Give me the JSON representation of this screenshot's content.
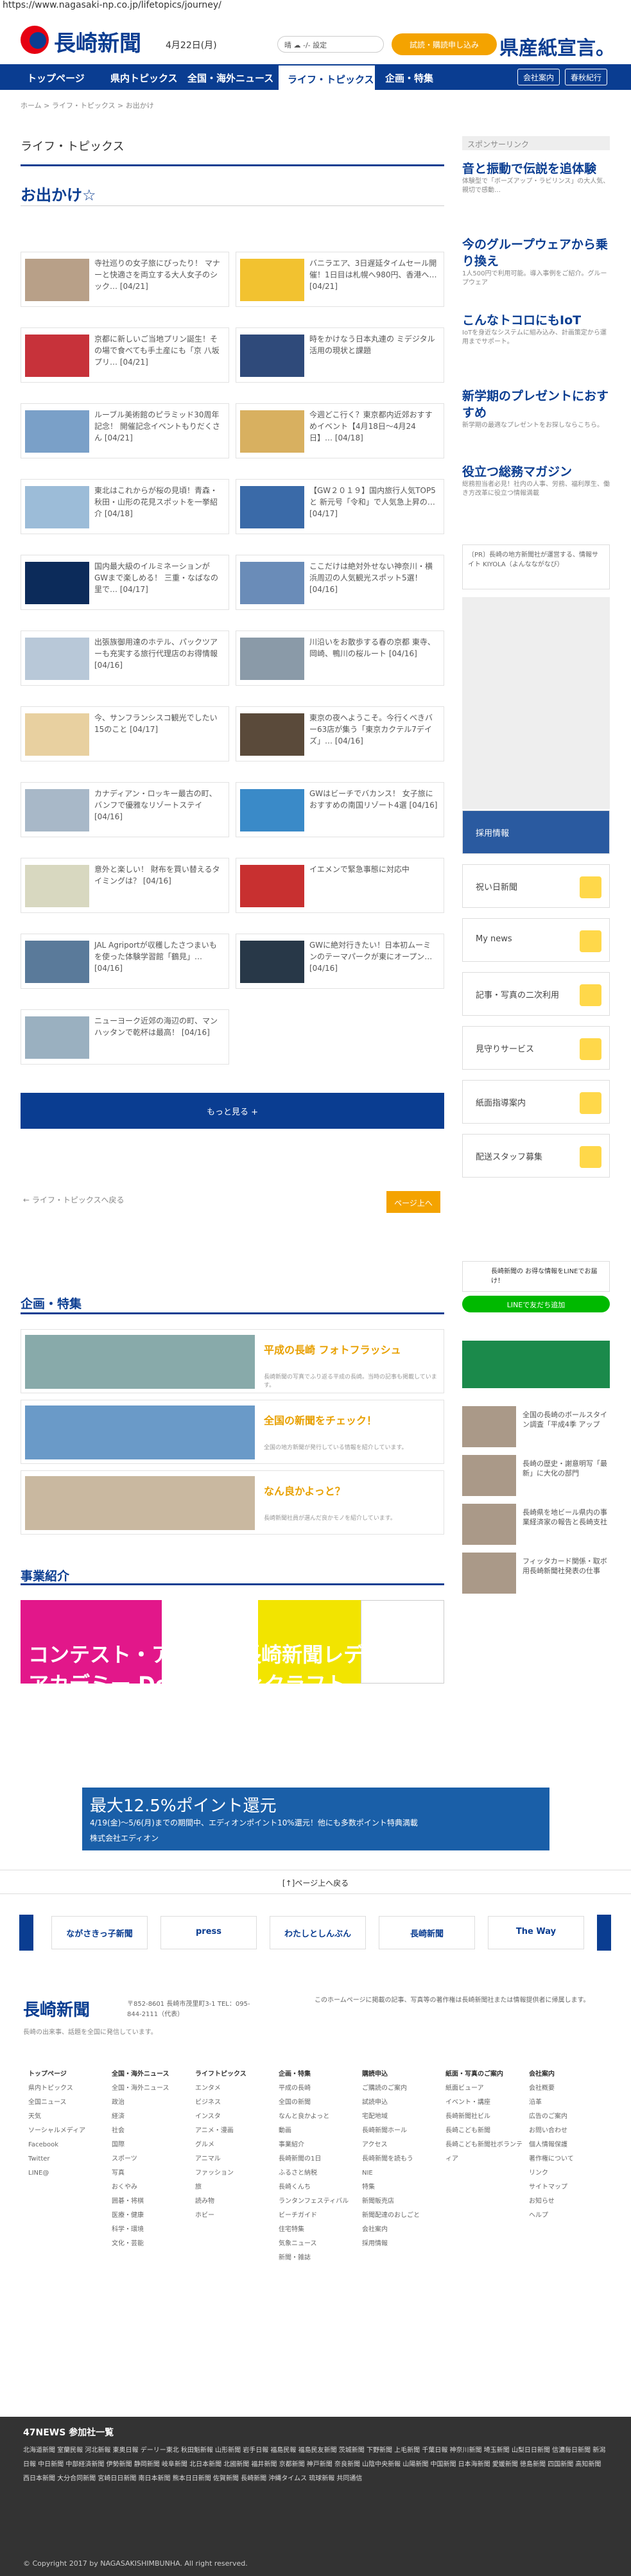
{
  "browser": {
    "url": "https://www.nagasaki-np.co.jp/lifetopics/journey/"
  },
  "header": {
    "logo": "長崎新聞",
    "date": "4月22日(月)",
    "weather": "晴 ☁ -/- 設定",
    "trial_label": "試読・購読申し込み",
    "campaign": "県産紙宣言。"
  },
  "gnav": {
    "items": [
      "トップページ",
      "県内トピックス",
      "全国・海外ニュース",
      "ライフ・トピックス",
      "企画・特集"
    ],
    "right": [
      "会社案内",
      "春秋紀行"
    ]
  },
  "breadcrumb": "ホーム > ライフ・トピックス > お出かけ",
  "section_title": "ライフ・トピックス",
  "page_heading": "お出かけ☆",
  "articles": [
    {
      "text": "寺社巡りの女子旅にぴったり！ マナーと快適さを両立する大人女子のシック… [04/21]"
    },
    {
      "text": "バニラエア、3日遅延タイムセール開催！1日目は札幌へ980円、香港へ… [04/21]"
    },
    {
      "text": "京都に新しいご当地プリン誕生！その場で食べても手土産にも「京 八坂プリ… [04/21]"
    },
    {
      "text": "時をかけなう日本丸連の ミデジタル活用の現状と課題"
    },
    {
      "text": "ルーブル美術館のピラミッド30周年記念！ 開催記念イベントもりだくさん [04/21]"
    },
    {
      "text": "今週どこ行く？東京都内近郊おすすめイベント【4月18日～4月24日】… [04/18]"
    },
    {
      "text": "東北はこれからが桜の見頃！青森・秋田・山形の花見スポットを一挙紹介 [04/18]"
    },
    {
      "text": "【GW２０１９】国内旅行人気TOP5と 新元号「令和」で人気急上昇の…[04/17]"
    },
    {
      "text": "国内最大級のイルミネーションがGWまで楽しめる！ 三重・なばなの里で… [04/17]"
    },
    {
      "text": "ここだけは絶対外せない神奈川・横浜周辺の人気観光スポット5選！[04/16]"
    },
    {
      "text": "出張族御用達のホテル、パックツアーも充実する旅行代理店のお得情報 [04/16]"
    },
    {
      "text": "川沿いをお散歩する春の京都 東寺、岡崎、鴨川の桜ルート [04/16]"
    },
    {
      "text": "今、サンフランシスコ観光でしたい15のこと [04/17]"
    },
    {
      "text": "東京の夜へようこそ。今行くべきバー63店が集う「東京カクテル7デイズ」… [04/16]"
    },
    {
      "text": "カナディアン・ロッキー最古の町、バンフで優雅なリゾートステイ [04/16]"
    },
    {
      "text": "GWはビーチでバカンス！ 女子旅におすすめの南国リゾート4選 [04/16]"
    },
    {
      "text": "意外と楽しい！ 財布を買い替えるタイミングは？ [04/16]"
    },
    {
      "text": "イエメンで緊急事態に対応中"
    },
    {
      "text": "JAL Agriportが収穫したさつまいもを使った体験学習館「鶴見」… [04/16]"
    },
    {
      "text": "GWに絶対行きたい！日本初ムーミンのテーマパークが東にオープン… [04/16]"
    },
    {
      "text": "ニューヨーク近郊の海辺の町、マンハッタンで乾杯は最高！ [04/16]"
    }
  ],
  "more_label": "もっと見る +",
  "back_left": "← ライフ・トピックスへ戻る",
  "back_right": "ページ上へ",
  "kikaku": {
    "heading": "企画・特集",
    "items": [
      {
        "title": "平成の長崎 フォトフラッシュ",
        "desc": "長崎新聞の写真でふり返る平成の長崎。当時の記事も掲載しています。"
      },
      {
        "title": "全国の新聞をチェック！",
        "desc": "全国の地方新聞が発行している情報を紹介しています。"
      },
      {
        "title": "なん良かよっと？",
        "desc": "長崎新聞社員が選んだ良かモノを紹介しています。"
      }
    ]
  },
  "jigyo": {
    "heading": "事業紹介",
    "banner": "コンテスト・アワード 長崎新聞レディスアカデミー Do-iT 地域×クラフト"
  },
  "ad_wide": {
    "line1": "最大12.5%ポイント還元",
    "line2": "4/19(金)～5/6(月)までの期間中、エディオンポイント10%還元！他にも多数ポイント特典満載",
    "line3": "株式会社エディオン"
  },
  "pagetop": "[↑]ページ上へ戻る",
  "ext_links": [
    "ながさきっ子新聞",
    "press",
    "わたしとしんぶん",
    "長崎新聞",
    "The Way"
  ],
  "footer": {
    "address": "〒852-8601 長崎市茂里町3-1 TEL：095-844-2111（代表）",
    "desc": "長崎の出来事、話題を全国に発信しています。",
    "about": "このホームページに掲載の記事、写真等の著作権は長崎新聞社または情報提供者に帰属します。",
    "cols": [
      {
        "title": "トップページ",
        "items": [
          "県内トピックス",
          "全国ニュース",
          "天気",
          "ソーシャルメディア",
          "Facebook",
          "Twitter",
          "LINE@"
        ]
      },
      {
        "title": "全国・海外ニュース",
        "items": [
          "全国・海外ニュース",
          "政治",
          "経済",
          "社会",
          "国際",
          "スポーツ",
          "写真",
          "おくやみ",
          "囲碁・将棋",
          "医療・健康",
          "科学・環境",
          "文化・芸能"
        ]
      },
      {
        "title": "ライフトピックス",
        "items": [
          "エンタメ",
          "ビジネス",
          "インスタ",
          "アニメ・漫画",
          "グルメ",
          "アニマル",
          "ファッション",
          "旅",
          "読み物",
          "ホビー"
        ]
      },
      {
        "title": "企画・特集",
        "items": [
          "平成の長崎",
          "全国の新聞",
          "なんと良かよっと",
          "動画",
          "事業紹介",
          "長崎新聞の1日",
          "ふるさと納税",
          "長崎くんち",
          "ランタンフェスティバル",
          "ビーチガイド",
          "住宅特集",
          "気象ニュース",
          "新聞・雑誌"
        ]
      },
      {
        "title": "購読申込",
        "items": [
          "ご購読のご案内",
          "試読申込",
          "宅配地域",
          "長崎新聞ホール",
          "アクセス",
          "長崎新聞を読もう",
          "NIE",
          "特集",
          "新聞販売店",
          "新聞配達のおしごと",
          "会社案内",
          "採用情報"
        ]
      },
      {
        "title": "紙面・写真のご案内",
        "items": [
          "紙面ビューア",
          "イベント・講座",
          "長崎新聞社ビル",
          "長崎こども新聞",
          "長崎こども新聞社ボランティア"
        ]
      },
      {
        "title": "会社案内",
        "items": [
          "会社概要",
          "沿革",
          "広告のご案内",
          "お問い合わせ",
          "個人情報保護",
          "著作権について",
          "リンク",
          "サイトマップ",
          "お知らせ",
          "ヘルプ"
        ]
      }
    ]
  },
  "dark_footer": {
    "title": "47NEWS 参加社一覧",
    "links": "北海道新聞 室蘭民報 河北新報 東奥日報 デーリー東北 秋田魁新報 山形新聞 岩手日報 福島民報 福島民友新聞 茨城新聞 下野新聞 上毛新聞 千葉日報 神奈川新聞 埼玉新聞 山梨日日新聞 信濃毎日新聞 新潟日報 中日新聞 中部経済新聞 伊勢新聞 静岡新聞 岐阜新聞 北日本新聞 北國新聞 福井新聞 京都新聞 神戸新聞 奈良新聞 山陰中央新報 山陽新聞 中国新聞 日本海新聞 愛媛新聞 徳島新聞 四国新聞 高知新聞 西日本新聞 大分合同新聞 宮崎日日新聞 南日本新聞 熊本日日新聞 佐賀新聞 長崎新聞 沖縄タイムス 琉球新報 共同通信"
  },
  "copyright": "© Copyright 2017 by NAGASAKISHIMBUNHA. All right reserved.",
  "sidebar": {
    "sponsor_label": "スポンサーリンク",
    "sponsors": [
      {
        "h": "音と振動で伝説を追体験",
        "p": "体験型で「ボーズアップ・ラビリンス」の大人気、親切で感動…"
      },
      {
        "h": "今のグループウェアから乗り換え",
        "p": "1人500円で利用可能。導入事例をご紹介。グループウェア"
      },
      {
        "h": "こんなトコロにもIoT",
        "p": "IoTを身近なシステムに組み込み、計画策定から運用までサポート。"
      },
      {
        "h": "新学期のプレゼントにおすすめ",
        "p": "新学期の最適なプレゼントをお探しならこちら。"
      },
      {
        "h": "役立つ総務マガジン",
        "p": "総務担当者必見！社内の人事、労務、福利厚生、働き方改革に役立つ情報満載"
      }
    ],
    "pr_note": "〔PR〕長崎の地方新聞社が運営する、情報サイト KIYOLA（よんなながなび）",
    "services": [
      "採用情報",
      "祝い日新聞",
      "My news",
      "記事・写真の二次利用",
      "見守りサービス",
      "紙面指導案内",
      "配送スタッフ募集"
    ],
    "line_box": "長崎新聞の お得な情報をLINEでお届け！",
    "line_btn": "LINEで友だち追加",
    "ranking": [
      "全国の長崎のボールスタイン調査「平成4季 アップ",
      "長崎の歴史・謝意明写「最新」に大化の部門",
      "長崎県を地ビール県内の事業経済家の報告と長崎支社",
      "フィッタカード関係・取ボ用長崎新聞社発表の仕事"
    ]
  }
}
